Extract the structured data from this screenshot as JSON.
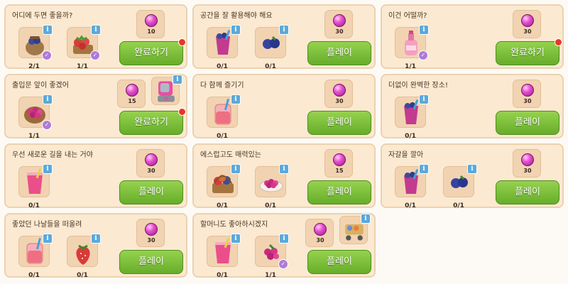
{
  "quests": [
    {
      "title": "어디에 두면 좋을까?",
      "reward": "10",
      "button": "완료하기",
      "alert": true,
      "items": [
        {
          "icon": "sack-icon",
          "count": "2/1",
          "done": true
        },
        {
          "icon": "strawberry-basket-icon",
          "count": "1/1",
          "done": true
        }
      ]
    },
    {
      "title": "공간을 잘 활용해야 해요",
      "reward": "30",
      "button": "플레이",
      "alert": false,
      "items": [
        {
          "icon": "smoothie-cup-icon",
          "count": "0/1",
          "done": false
        },
        {
          "icon": "blueberry-icon",
          "count": "0/1",
          "done": false
        }
      ]
    },
    {
      "title": "이건 어떨까?",
      "reward": "30",
      "button": "완료하기",
      "alert": true,
      "items": [
        {
          "icon": "lotion-bottle-icon",
          "count": "1/1",
          "done": true
        }
      ]
    },
    {
      "title": "출입문 앞이 좋겠어",
      "reward": "15",
      "button": "완료하기",
      "alert": true,
      "extra": "blender-icon",
      "items": [
        {
          "icon": "berry-basket-icon",
          "count": "1/1",
          "done": true
        }
      ]
    },
    {
      "title": "다 함께 즐기기",
      "reward": "30",
      "button": "플레이",
      "alert": false,
      "items": [
        {
          "icon": "juice-jar-icon",
          "count": "0/1",
          "done": false
        }
      ]
    },
    {
      "title": "더없이 완벽한 장소!",
      "reward": "30",
      "button": "플레이",
      "alert": false,
      "items": [
        {
          "icon": "smoothie-cup-icon",
          "count": "0/1",
          "done": false
        }
      ]
    },
    {
      "title": "우선 새로운 길을 내는 거야",
      "reward": "30",
      "button": "플레이",
      "alert": false,
      "items": [
        {
          "icon": "pink-smoothie-icon",
          "count": "0/1",
          "done": false
        }
      ]
    },
    {
      "title": "에스럽고도 매력있는",
      "reward": "15",
      "button": "플레이",
      "alert": false,
      "items": [
        {
          "icon": "fruit-basket-icon",
          "count": "0/1",
          "done": false
        },
        {
          "icon": "berry-plate-icon",
          "count": "0/1",
          "done": false
        }
      ]
    },
    {
      "title": "자갈을 깔아",
      "reward": "30",
      "button": "플레이",
      "alert": false,
      "items": [
        {
          "icon": "smoothie-cup-icon",
          "count": "0/1",
          "done": false
        },
        {
          "icon": "blueberry-icon",
          "count": "0/1",
          "done": false
        }
      ]
    },
    {
      "title": "좋았던 나날들을 떠올려",
      "reward": "30",
      "button": "플레이",
      "alert": false,
      "items": [
        {
          "icon": "juice-jar-icon",
          "count": "0/1",
          "done": false
        },
        {
          "icon": "strawberry-icon",
          "count": "0/1",
          "done": false
        }
      ]
    },
    {
      "title": "할머니도 좋아하시겠지",
      "reward": "30",
      "button": "플레이",
      "alert": false,
      "extra": "garden-cart-icon",
      "items": [
        {
          "icon": "pink-smoothie-icon",
          "count": "0/1",
          "done": false
        },
        {
          "icon": "raspberry-icon",
          "count": "1/1",
          "done": true
        }
      ]
    }
  ],
  "colors": {
    "button": "#7cc03a",
    "gem": "#e64fd0",
    "info": "#5aa9dc",
    "check": "#b07ad8",
    "alert": "#e8372a"
  }
}
